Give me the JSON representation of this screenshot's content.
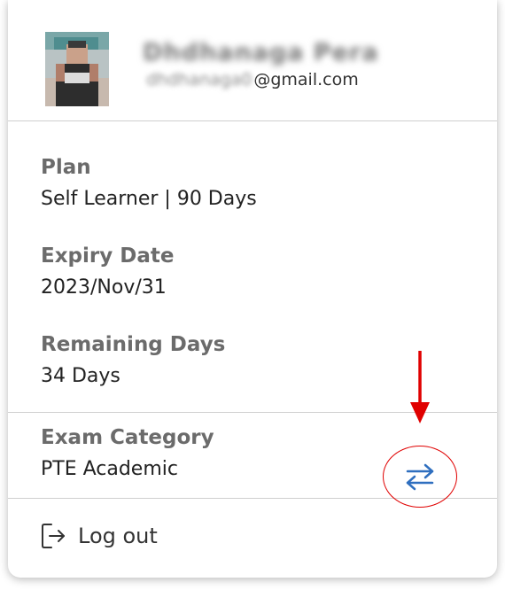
{
  "profile": {
    "name_blurred": "Dhdhanaga Pera",
    "email_blurred": "dhdhanaga0",
    "email_domain": "@gmail.com"
  },
  "plan": {
    "label": "Plan",
    "value": "Self Learner | 90 Days"
  },
  "expiry": {
    "label": "Expiry Date",
    "value": "2023/Nov/31"
  },
  "remaining": {
    "label": "Remaining Days",
    "value": "34 Days"
  },
  "exam": {
    "label": "Exam Category",
    "value": "PTE Academic"
  },
  "logout": {
    "label": "Log out"
  },
  "colors": {
    "accent_blue": "#2f6fbf",
    "annotation_red": "#e00000"
  },
  "icons": {
    "switch": "swap-arrows-icon",
    "logout": "logout-icon",
    "annotation": "down-arrow-icon"
  }
}
